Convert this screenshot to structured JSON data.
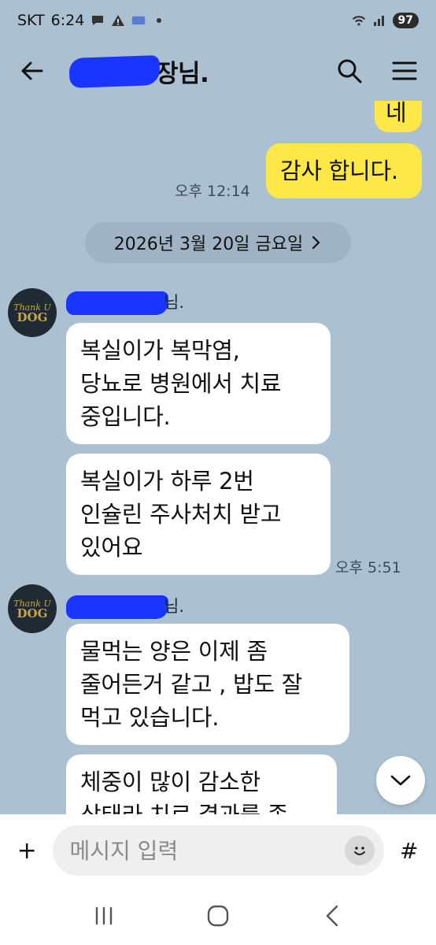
{
  "status_bar": {
    "carrier": "SKT",
    "time": "6:24",
    "battery": "97",
    "icons": [
      "chat-bubble-icon",
      "warning-icon",
      "app-icon",
      "dot-icon",
      "wifi-icon",
      "signal-icon"
    ]
  },
  "header": {
    "title_visible": "장님.",
    "icons": {
      "back": "arrow-left-icon",
      "search": "search-icon",
      "menu": "hamburger-menu-icon"
    }
  },
  "messages": {
    "out_partial": "네",
    "out_thanks": "감사 합니다.",
    "out_thanks_time": "오후 12:14",
    "date_divider": "2026년 3월 20일 금요일",
    "group1": {
      "sender_suffix": "님.",
      "bubble1": [
        "복실이가 복막염,",
        "당뇨로 병원에서 치료",
        "중입니다."
      ],
      "bubble2": [
        "복실이가 하루 2번",
        "인슐린 주사처치 받고",
        "있어요"
      ],
      "time": "오후 5:51"
    },
    "group2": {
      "sender_suffix": "님.",
      "bubble1": [
        "물먹는 양은 이제 좀",
        "줄어든거 같고 , 밥도 잘",
        "먹고 있습니다."
      ],
      "bubble2": [
        "체중이 많이 감소한",
        "상태라 치료 결과를 좀"
      ]
    },
    "avatar_text": {
      "line1": "Thank U",
      "line2": "DOG"
    }
  },
  "composer": {
    "placeholder": "메시지 입력",
    "plus": "+",
    "hash": "#"
  },
  "colors": {
    "chat_bg": "#abc1d1",
    "outgoing_bubble": "#fde848",
    "incoming_bubble": "#ffffff",
    "redaction": "#1a35ff"
  }
}
